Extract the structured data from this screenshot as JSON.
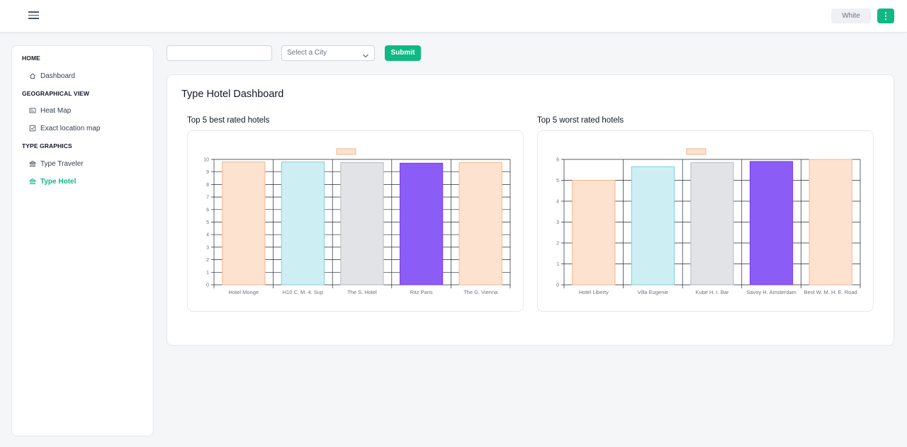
{
  "topbar": {
    "theme_label": "White",
    "kebab_label": "⋮"
  },
  "sidebar": {
    "sections": [
      {
        "title": "HOME"
      },
      {
        "title": "GEOGRAPHICAL VIEW"
      },
      {
        "title": "TYPE GRAPHICS"
      }
    ],
    "items": [
      {
        "label": "Dashboard",
        "icon": "home-icon"
      },
      {
        "label": "Heat Map",
        "icon": "map-card-icon"
      },
      {
        "label": "Exact location map",
        "icon": "check-square-icon"
      },
      {
        "label": "Type Traveler",
        "icon": "bank-icon"
      },
      {
        "label": "Type Hotel",
        "icon": "bank-icon"
      }
    ]
  },
  "filters": {
    "search_value": "",
    "city_placeholder": "Select a City",
    "submit_label": "Submit"
  },
  "page": {
    "title": "Type Hotel Dashboard"
  },
  "colors": {
    "peach_fill": "#fde2d0",
    "peach_stroke": "#f6b48a",
    "cyan_fill": "#cdeff4",
    "cyan_stroke": "#7fcfdd",
    "grey_fill": "#e2e3e6",
    "grey_stroke": "#b7b9be",
    "purple_fill": "#8b5cf6",
    "purple_stroke": "#7c3aed",
    "accent": "#10b981"
  },
  "chart_data": [
    {
      "type": "bar",
      "title": "Top 5 best rated hotels",
      "categories": [
        "Hotel Monge",
        "H10 C. M. 4. Sup",
        "The S. Hotel",
        "Ritz Paris",
        "The G. Vienna"
      ],
      "values": [
        9.8,
        9.8,
        9.75,
        9.7,
        9.75
      ],
      "bar_colors": [
        "peach",
        "cyan",
        "grey",
        "purple",
        "peach"
      ],
      "ylim": [
        0,
        10
      ],
      "yticks": [
        0,
        1,
        2,
        3,
        4,
        5,
        6,
        7,
        8,
        9,
        10
      ],
      "grid": true,
      "legend": "top-center"
    },
    {
      "type": "bar",
      "title": "Top 5 worst rated hotels",
      "categories": [
        "Hotel Liberty",
        "Villa Eugenie",
        "Kube H. I. Bar",
        "Savoy H. Amsterdam",
        "Best W. M. H. E. Road"
      ],
      "values": [
        5.0,
        5.65,
        5.85,
        5.9,
        6.0
      ],
      "bar_colors": [
        "peach",
        "cyan",
        "grey",
        "purple",
        "peach"
      ],
      "ylim": [
        0,
        6
      ],
      "yticks": [
        0,
        1,
        2,
        3,
        4,
        5,
        6
      ],
      "grid": true,
      "legend": "top-center"
    }
  ]
}
